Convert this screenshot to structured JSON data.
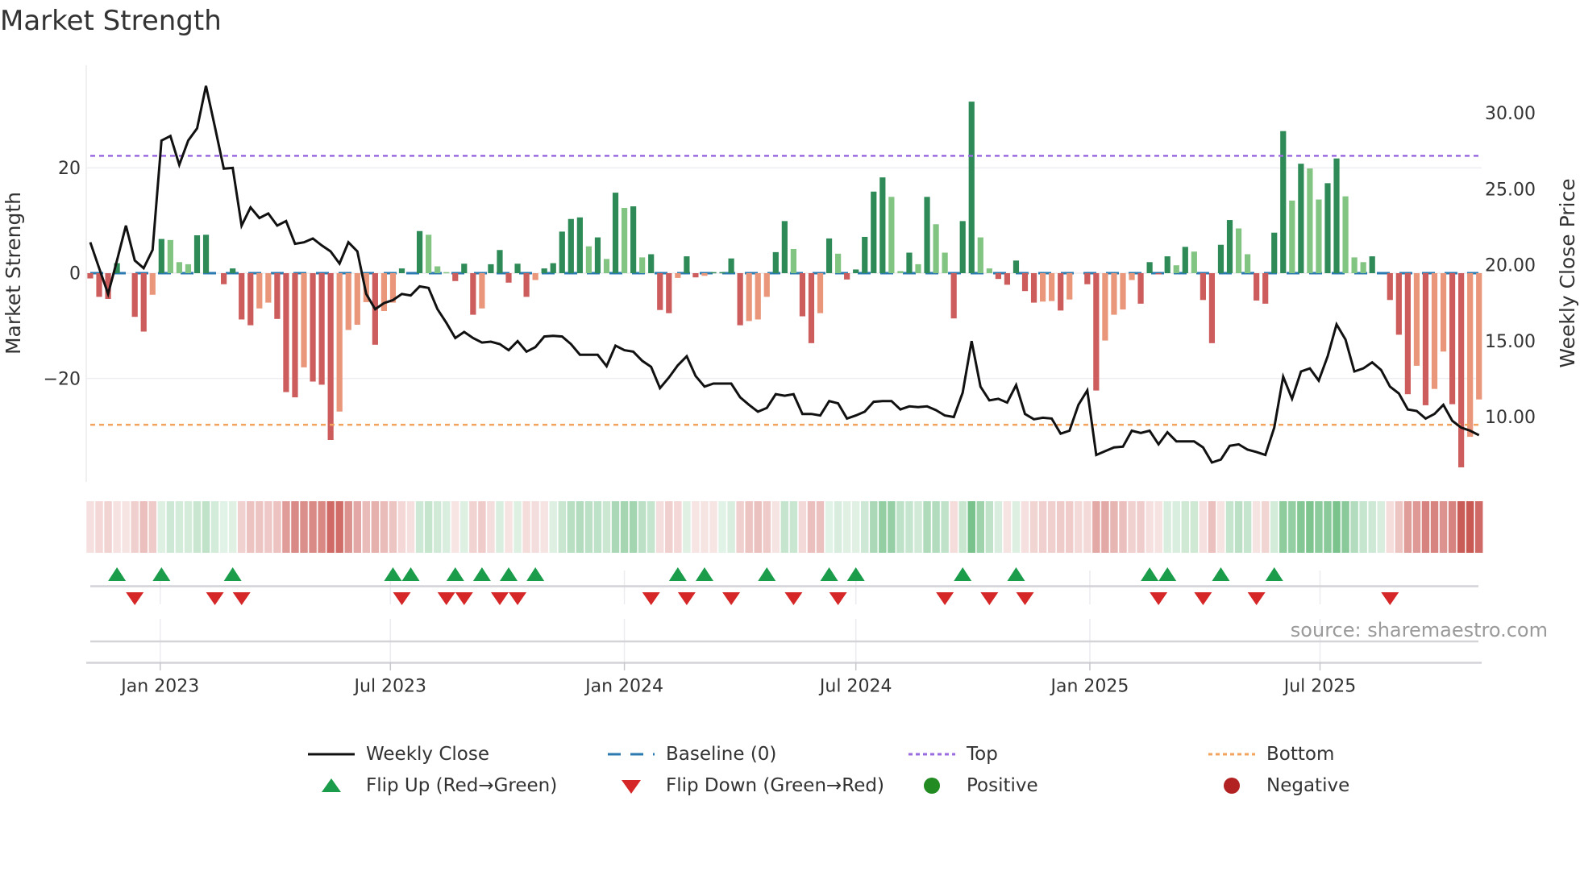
{
  "title": "Market Strength",
  "source": "source: sharemaestro.com",
  "legend": {
    "weekly_close": "Weekly Close",
    "baseline": "Baseline (0)",
    "top": "Top",
    "bottom": "Bottom",
    "flip_up": "Flip Up (Red→Green)",
    "flip_down": "Flip Down (Green→Red)",
    "positive": "Positive",
    "negative": "Negative"
  },
  "colors": {
    "bar_pos_strong": "#2e8b57",
    "bar_pos_weak": "#82c482",
    "bar_neg_strong": "#cd5c5c",
    "bar_neg_weak": "#e9967a",
    "close_line": "#111111",
    "baseline": "#2a7ab0",
    "top": "#9b6be0",
    "bottom": "#f2a35e",
    "flip_up": "#1a9c4a",
    "flip_down": "#d62728",
    "positive": "#228b22",
    "negative": "#b22222"
  },
  "chart_data": {
    "type": "bar+line",
    "title": "Market Strength",
    "ylabel": "Market Strength",
    "y2label": "Weekly Close Price",
    "ylim": [
      -39,
      36
    ],
    "y2lim": [
      6.5,
      33
    ],
    "start_date": "2022-11-07",
    "interval_days": 7,
    "top_level": 22.3,
    "bottom_level": -28.8,
    "baseline": 0,
    "yticks": [
      {
        "value": 20,
        "label": "20"
      },
      {
        "value": 0,
        "label": "0"
      },
      {
        "value": -20,
        "label": "−20"
      }
    ],
    "y2ticks": [
      {
        "value": 30,
        "label": "30.00"
      },
      {
        "value": 25,
        "label": "25.00"
      },
      {
        "value": 20,
        "label": "20.00"
      },
      {
        "value": 15,
        "label": "15.00"
      },
      {
        "value": 10,
        "label": "10.00"
      }
    ],
    "xticks": [
      {
        "date": "2023-01-01",
        "label": "Jan 2023"
      },
      {
        "date": "2023-07-01",
        "label": "Jul 2023"
      },
      {
        "date": "2024-01-01",
        "label": "Jan 2024"
      },
      {
        "date": "2024-07-01",
        "label": "Jul 2024"
      },
      {
        "date": "2025-01-01",
        "label": "Jan 2025"
      },
      {
        "date": "2025-07-01",
        "label": "Jul 2025"
      }
    ],
    "strength": [
      -1.0,
      -4.5,
      -4.9,
      1.9,
      0,
      -8.3,
      -11.1,
      -4.1,
      6.5,
      6.3,
      2.1,
      1.7,
      7.2,
      7.3,
      0,
      -2.1,
      0.9,
      -8.8,
      -9.9,
      -6.7,
      -5.6,
      -8.7,
      -22.6,
      -23.6,
      -17.9,
      -20.6,
      -21.2,
      -31.7,
      -26.3,
      -10.8,
      -9.8,
      -5.5,
      -13.6,
      -7.2,
      -5.6,
      0.9,
      0,
      8.0,
      7.3,
      1.3,
      0.2,
      -1.5,
      1.8,
      -7.9,
      -6.7,
      1.7,
      4.4,
      -1.8,
      1.8,
      -4.5,
      -1.3,
      0.9,
      1.9,
      7.9,
      10.3,
      10.6,
      5.1,
      6.8,
      2.7,
      15.3,
      12.4,
      12.7,
      3.0,
      3.6,
      -7.0,
      -7.6,
      -0.9,
      3.2,
      -0.8,
      -0.5,
      0.2,
      0.2,
      2.8,
      -9.9,
      -9.1,
      -8.8,
      -4.5,
      4.0,
      9.9,
      4.6,
      -8.2,
      -13.3,
      -7.6,
      6.6,
      3.7,
      -1.2,
      0.7,
      6.9,
      15.5,
      18.2,
      14.5,
      0.4,
      3.9,
      1.7,
      14.5,
      9.3,
      3.9,
      -8.6,
      9.9,
      32.6,
      6.8,
      0.9,
      -1.1,
      -2.2,
      2.4,
      -3.4,
      -5.6,
      -5.4,
      -5.3,
      -7.1,
      -5.0,
      0,
      -2.1,
      -22.3,
      -12.8,
      -7.9,
      -6.9,
      -1.3,
      -5.8,
      2.1,
      -0.2,
      3.2,
      1.5,
      5.0,
      4.1,
      -5.1,
      -13.3,
      5.4,
      10.1,
      8.5,
      3.6,
      -5.2,
      -5.8,
      7.7,
      27.0,
      13.8,
      20.8,
      19.9,
      14.0,
      17.1,
      21.8,
      14.6,
      3.0,
      2.1,
      3.2,
      0,
      -5.1,
      -11.7,
      -23.0,
      -17.6,
      -25.1,
      -22.0,
      -14.9,
      -24.9,
      -36.9,
      -31.1,
      -24.0
    ],
    "close": [
      21.5,
      19.8,
      18.1,
      20.3,
      22.6,
      20.3,
      19.8,
      21.0,
      28.2,
      28.5,
      26.6,
      28.2,
      29.0,
      31.8,
      29.1,
      26.35,
      26.4,
      22.6,
      23.8,
      23.1,
      23.4,
      22.6,
      22.9,
      21.4,
      21.5,
      21.75,
      21.3,
      20.9,
      20.1,
      21.5,
      20.9,
      18.1,
      17.1,
      17.5,
      17.7,
      18.1,
      18.0,
      18.6,
      18.5,
      17.1,
      16.2,
      15.2,
      15.6,
      15.2,
      14.9,
      14.96,
      14.8,
      14.4,
      15.0,
      14.3,
      14.6,
      15.3,
      15.35,
      15.3,
      14.8,
      14.1,
      14.1,
      14.1,
      13.35,
      14.7,
      14.4,
      14.3,
      13.7,
      13.3,
      11.9,
      12.6,
      13.4,
      14.0,
      12.7,
      12.0,
      12.2,
      12.2,
      12.2,
      11.3,
      10.8,
      10.35,
      10.6,
      11.5,
      11.4,
      11.5,
      10.2,
      10.2,
      10.1,
      11.05,
      10.9,
      9.9,
      10.1,
      10.35,
      11.0,
      11.05,
      11.05,
      10.5,
      10.7,
      10.65,
      10.7,
      10.45,
      10.1,
      10.0,
      11.6,
      15.0,
      12.0,
      11.1,
      11.2,
      10.95,
      12.1,
      10.2,
      9.85,
      9.95,
      9.9,
      8.9,
      9.1,
      10.8,
      11.75,
      7.5,
      7.75,
      8.0,
      8.05,
      9.1,
      8.95,
      9.1,
      8.2,
      9.0,
      8.4,
      8.4,
      8.4,
      8.0,
      7.0,
      7.2,
      8.1,
      8.2,
      7.85,
      7.7,
      7.5,
      9.3,
      12.65,
      11.2,
      13.0,
      13.2,
      12.4,
      14.0,
      16.1,
      15.1,
      13.0,
      13.2,
      13.6,
      13.1,
      12.0,
      11.55,
      10.5,
      10.4,
      9.9,
      10.2,
      10.8,
      9.75,
      9.3,
      9.1,
      8.8
    ],
    "flip_up_weeks": [
      4,
      9,
      17,
      35,
      37,
      42,
      45,
      48,
      51,
      67,
      70,
      77,
      84,
      87,
      99,
      105,
      120,
      122,
      128,
      134
    ],
    "flip_down_weeks": [
      6,
      15,
      18,
      36,
      41,
      43,
      47,
      49,
      64,
      68,
      73,
      80,
      85,
      97,
      102,
      106,
      121,
      126,
      132,
      147
    ],
    "legend_position": "bottom"
  }
}
